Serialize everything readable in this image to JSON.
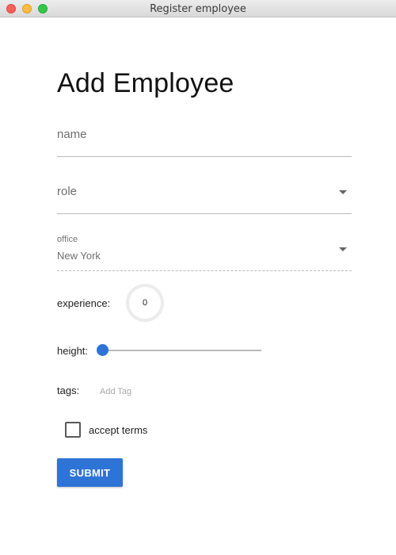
{
  "window": {
    "title": "Register employee",
    "controls": [
      "close",
      "minimize",
      "zoom"
    ]
  },
  "form": {
    "title": "Add Employee",
    "name": {
      "placeholder": "name",
      "value": ""
    },
    "role": {
      "placeholder": "role",
      "value": "",
      "icon": "chevron-down-icon"
    },
    "office": {
      "label": "office",
      "value": "New York",
      "icon": "chevron-down-icon"
    },
    "experience": {
      "label": "experience:",
      "value": "0"
    },
    "height": {
      "label": "height:",
      "value_fraction": 0
    },
    "tags": {
      "label": "tags:",
      "placeholder": "Add Tag"
    },
    "terms": {
      "label": "accept terms",
      "checked": false
    },
    "submit_label": "SUBMIT"
  },
  "colors": {
    "accent": "#2e74d6",
    "underline": "#bcbcbc",
    "text_muted": "#6f6f6f"
  }
}
